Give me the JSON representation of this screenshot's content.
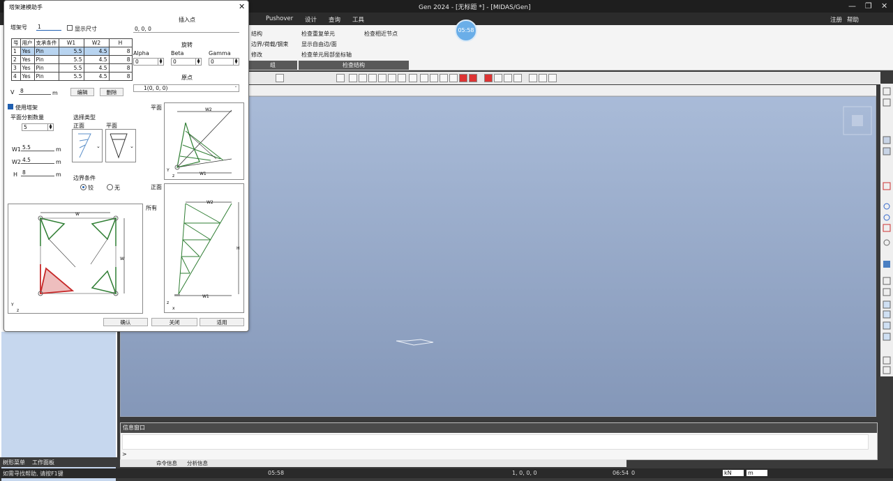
{
  "app": {
    "title": "Gen 2024 - [无标题 *] - [MIDAS/Gen]",
    "window_controls": [
      "—",
      "❐",
      "✕"
    ]
  },
  "menu": {
    "items": [
      "Pushover",
      "设计",
      "查询",
      "工具"
    ],
    "right_items": [
      "注册",
      "帮助"
    ]
  },
  "ribbon": {
    "left_items": [
      "结构",
      "边界/荷载/钢束",
      "修改"
    ],
    "check_items": [
      "检查重复单元",
      "检查相近节点",
      "显示自由边/面",
      "检查单元局部坐标轴"
    ],
    "groups": [
      "组",
      "检查结构"
    ],
    "timer": "05:58"
  },
  "dialog": {
    "title": "塔架建模助手",
    "tower_no_label": "塔架号",
    "tower_no_value": "1",
    "show_size_label": "显示尺寸",
    "table": {
      "headers": [
        "号",
        "用户",
        "支承条件",
        "W1",
        "W2",
        "H"
      ],
      "rows": [
        [
          "1",
          "Yes",
          "Pin",
          "5.5",
          "4.5",
          "8"
        ],
        [
          "2",
          "Yes",
          "Pin",
          "5.5",
          "4.5",
          "8"
        ],
        [
          "3",
          "Yes",
          "Pin",
          "5.5",
          "4.5",
          "8"
        ],
        [
          "4",
          "Yes",
          "Pin",
          "5.5",
          "4.5",
          "8"
        ]
      ]
    },
    "v_label": "V",
    "v_value": "8",
    "v_unit": "m",
    "edit_button": "编辑",
    "delete_button": "删除",
    "insert_point_title": "插入点",
    "insert_point_value": "0, 0, 0",
    "rotation_title": "旋转",
    "alpha_label": "Alpha",
    "beta_label": "Beta",
    "gamma_label": "Gamma",
    "alpha_value": "0",
    "beta_value": "0",
    "gamma_value": "0",
    "origin_title": "原点",
    "origin_value": "1(0, 0, 0)",
    "use_tower_label": "使用塔架",
    "plane_division_label": "平面分割数量",
    "plane_division_value": "5",
    "w1_label": "W1",
    "w1_value": "5.5",
    "w2_label": "W2",
    "w2_value": "4.5",
    "h_label": "H",
    "h_value": "8",
    "unit_m": "m",
    "select_type_label": "选择类型",
    "front_label": "正面",
    "plan_label": "平面",
    "boundary_label": "边界条件",
    "radio_hinge": "铰",
    "radio_none": "无",
    "plan_view_label": "平面",
    "front_view_label": "正面",
    "all_label": "所有",
    "dim_w": "W",
    "dim_w1": "W1",
    "dim_w2": "W2",
    "dim_h": "H",
    "confirm_button": "确认",
    "close_button": "关闭",
    "apply_button": "适用"
  },
  "left_tabs": [
    "树形菜单",
    "工作面板"
  ],
  "message_window": {
    "title": "信息窗口",
    "prompt": ">",
    "tabs": [
      "命令信息",
      "分析信息"
    ]
  },
  "status": {
    "help_text": "如需寻找帮助, 请按F1键",
    "time_left": "05:58",
    "node_text": "1, 0, 0, 0",
    "time_right": "06:54",
    "unit_force": "kN",
    "unit_len": "m",
    "value": "0"
  }
}
